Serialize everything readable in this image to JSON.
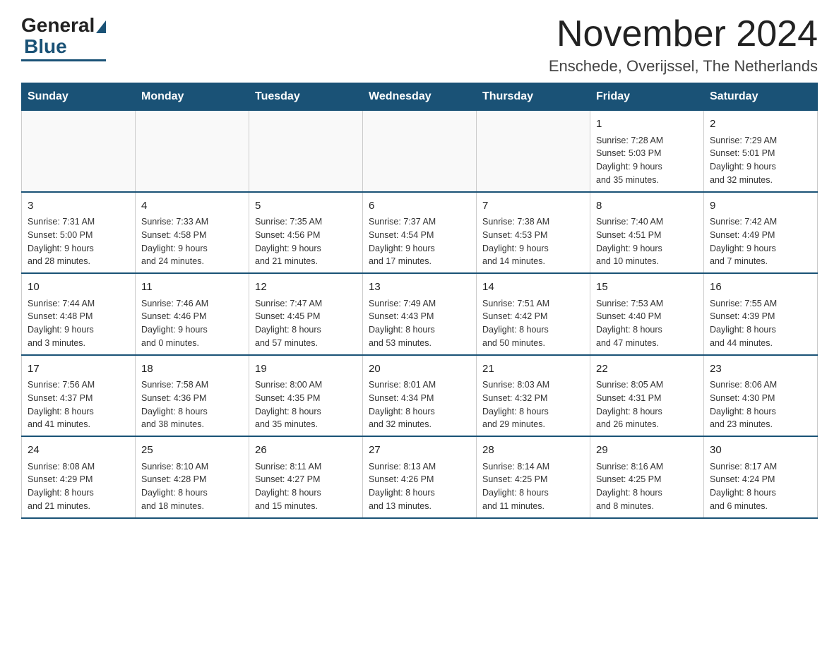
{
  "logo": {
    "general": "General",
    "blue": "Blue"
  },
  "header": {
    "month_title": "November 2024",
    "location": "Enschede, Overijssel, The Netherlands"
  },
  "weekdays": [
    "Sunday",
    "Monday",
    "Tuesday",
    "Wednesday",
    "Thursday",
    "Friday",
    "Saturday"
  ],
  "weeks": [
    [
      {
        "day": "",
        "info": ""
      },
      {
        "day": "",
        "info": ""
      },
      {
        "day": "",
        "info": ""
      },
      {
        "day": "",
        "info": ""
      },
      {
        "day": "",
        "info": ""
      },
      {
        "day": "1",
        "info": "Sunrise: 7:28 AM\nSunset: 5:03 PM\nDaylight: 9 hours\nand 35 minutes."
      },
      {
        "day": "2",
        "info": "Sunrise: 7:29 AM\nSunset: 5:01 PM\nDaylight: 9 hours\nand 32 minutes."
      }
    ],
    [
      {
        "day": "3",
        "info": "Sunrise: 7:31 AM\nSunset: 5:00 PM\nDaylight: 9 hours\nand 28 minutes."
      },
      {
        "day": "4",
        "info": "Sunrise: 7:33 AM\nSunset: 4:58 PM\nDaylight: 9 hours\nand 24 minutes."
      },
      {
        "day": "5",
        "info": "Sunrise: 7:35 AM\nSunset: 4:56 PM\nDaylight: 9 hours\nand 21 minutes."
      },
      {
        "day": "6",
        "info": "Sunrise: 7:37 AM\nSunset: 4:54 PM\nDaylight: 9 hours\nand 17 minutes."
      },
      {
        "day": "7",
        "info": "Sunrise: 7:38 AM\nSunset: 4:53 PM\nDaylight: 9 hours\nand 14 minutes."
      },
      {
        "day": "8",
        "info": "Sunrise: 7:40 AM\nSunset: 4:51 PM\nDaylight: 9 hours\nand 10 minutes."
      },
      {
        "day": "9",
        "info": "Sunrise: 7:42 AM\nSunset: 4:49 PM\nDaylight: 9 hours\nand 7 minutes."
      }
    ],
    [
      {
        "day": "10",
        "info": "Sunrise: 7:44 AM\nSunset: 4:48 PM\nDaylight: 9 hours\nand 3 minutes."
      },
      {
        "day": "11",
        "info": "Sunrise: 7:46 AM\nSunset: 4:46 PM\nDaylight: 9 hours\nand 0 minutes."
      },
      {
        "day": "12",
        "info": "Sunrise: 7:47 AM\nSunset: 4:45 PM\nDaylight: 8 hours\nand 57 minutes."
      },
      {
        "day": "13",
        "info": "Sunrise: 7:49 AM\nSunset: 4:43 PM\nDaylight: 8 hours\nand 53 minutes."
      },
      {
        "day": "14",
        "info": "Sunrise: 7:51 AM\nSunset: 4:42 PM\nDaylight: 8 hours\nand 50 minutes."
      },
      {
        "day": "15",
        "info": "Sunrise: 7:53 AM\nSunset: 4:40 PM\nDaylight: 8 hours\nand 47 minutes."
      },
      {
        "day": "16",
        "info": "Sunrise: 7:55 AM\nSunset: 4:39 PM\nDaylight: 8 hours\nand 44 minutes."
      }
    ],
    [
      {
        "day": "17",
        "info": "Sunrise: 7:56 AM\nSunset: 4:37 PM\nDaylight: 8 hours\nand 41 minutes."
      },
      {
        "day": "18",
        "info": "Sunrise: 7:58 AM\nSunset: 4:36 PM\nDaylight: 8 hours\nand 38 minutes."
      },
      {
        "day": "19",
        "info": "Sunrise: 8:00 AM\nSunset: 4:35 PM\nDaylight: 8 hours\nand 35 minutes."
      },
      {
        "day": "20",
        "info": "Sunrise: 8:01 AM\nSunset: 4:34 PM\nDaylight: 8 hours\nand 32 minutes."
      },
      {
        "day": "21",
        "info": "Sunrise: 8:03 AM\nSunset: 4:32 PM\nDaylight: 8 hours\nand 29 minutes."
      },
      {
        "day": "22",
        "info": "Sunrise: 8:05 AM\nSunset: 4:31 PM\nDaylight: 8 hours\nand 26 minutes."
      },
      {
        "day": "23",
        "info": "Sunrise: 8:06 AM\nSunset: 4:30 PM\nDaylight: 8 hours\nand 23 minutes."
      }
    ],
    [
      {
        "day": "24",
        "info": "Sunrise: 8:08 AM\nSunset: 4:29 PM\nDaylight: 8 hours\nand 21 minutes."
      },
      {
        "day": "25",
        "info": "Sunrise: 8:10 AM\nSunset: 4:28 PM\nDaylight: 8 hours\nand 18 minutes."
      },
      {
        "day": "26",
        "info": "Sunrise: 8:11 AM\nSunset: 4:27 PM\nDaylight: 8 hours\nand 15 minutes."
      },
      {
        "day": "27",
        "info": "Sunrise: 8:13 AM\nSunset: 4:26 PM\nDaylight: 8 hours\nand 13 minutes."
      },
      {
        "day": "28",
        "info": "Sunrise: 8:14 AM\nSunset: 4:25 PM\nDaylight: 8 hours\nand 11 minutes."
      },
      {
        "day": "29",
        "info": "Sunrise: 8:16 AM\nSunset: 4:25 PM\nDaylight: 8 hours\nand 8 minutes."
      },
      {
        "day": "30",
        "info": "Sunrise: 8:17 AM\nSunset: 4:24 PM\nDaylight: 8 hours\nand 6 minutes."
      }
    ]
  ]
}
